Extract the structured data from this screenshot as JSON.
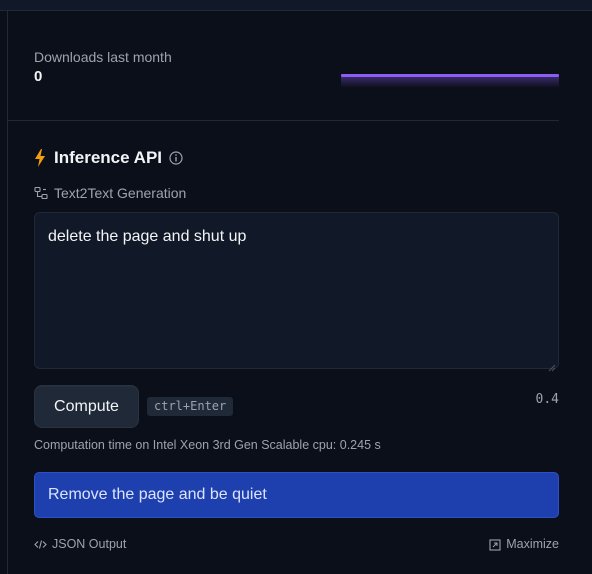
{
  "downloads": {
    "label": "Downloads last month",
    "count": "0"
  },
  "colors": {
    "background": "#0b0f19",
    "chart_line": "#8b5cf6",
    "bolt": "#f59e0b",
    "output_bg": "#1e40af"
  },
  "inference": {
    "title": "Inference API",
    "task": "Text2Text Generation",
    "input_text": "delete the page and shut up",
    "compute_label": "Compute",
    "shortcut": "ctrl+Enter",
    "version": "0.4",
    "computation_time": "Computation time on Intel Xeon 3rd Gen Scalable cpu: 0.245 s",
    "output_text": "Remove the page and be quiet",
    "json_output_label": "JSON Output",
    "maximize_label": "Maximize"
  },
  "icons": {
    "title": "lightning-bolt-icon",
    "info": "info-icon",
    "task": "text2text-icon",
    "json": "code-icon",
    "maximize": "maximize-icon"
  }
}
